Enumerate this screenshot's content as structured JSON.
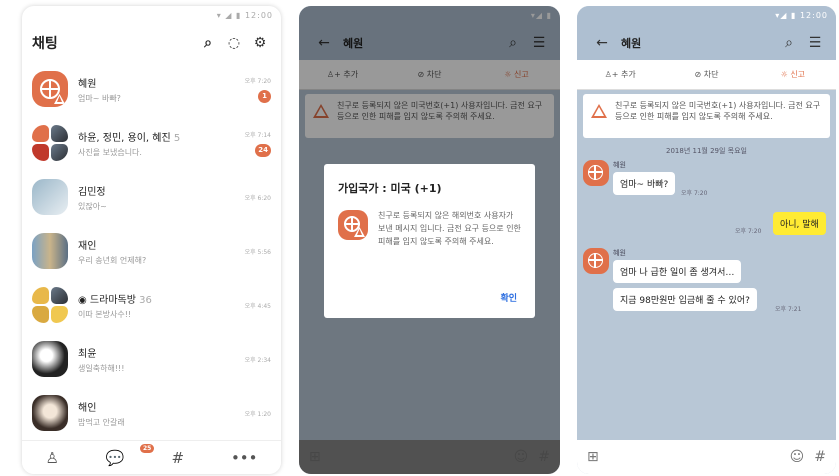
{
  "status_time": "12:00",
  "screen1": {
    "title": "채팅",
    "chats": [
      {
        "name": "혜원",
        "count": "",
        "preview": "엄마~ 바빠?",
        "time": "오후 7:20",
        "badge": "1",
        "avatar": "globe"
      },
      {
        "name": "하윤, 정민, 용이, 혜진",
        "count": "5",
        "preview": "사진을 보냈습니다.",
        "time": "오후 7:14",
        "badge": "24",
        "avatar": "group"
      },
      {
        "name": "김민정",
        "count": "",
        "preview": "있잖아~",
        "time": "오후 6:20",
        "badge": "",
        "avatar": "photo"
      },
      {
        "name": "재인",
        "count": "",
        "preview": "우리 송년회 언제해?",
        "time": "오후 5:56",
        "badge": "",
        "avatar": "photo"
      },
      {
        "name": "드라마독방",
        "count": "36",
        "preview": "이따 본방사수!!",
        "time": "오후 4:45",
        "badge": "",
        "avatar": "group"
      },
      {
        "name": "최윤",
        "count": "",
        "preview": "생일축하해!!!",
        "time": "오후 2:34",
        "badge": "",
        "avatar": "photo"
      },
      {
        "name": "해인",
        "count": "",
        "preview": "밥먹고 안갈래",
        "time": "오후 1:20",
        "badge": "",
        "avatar": "photo"
      }
    ],
    "nav_badge": "25"
  },
  "screen2": {
    "title": "혜원",
    "actions": {
      "add": "추가",
      "block": "차단",
      "report": "신고"
    },
    "notice": "친구로 등록되지 않은 미국번호(+1) 사용자입니다. 금전 요구 등으로 인한 피해를 입지 않도록 주의해 주세요.",
    "dialog": {
      "title": "가입국가 : 미국 (+1)",
      "body": "친구로 등록되지 않은 해외번호 사용자가 보낸 메시지 입니다. 금전 요구 등으로 인한 피해를 입지 않도록 주의해 주세요.",
      "ok": "확인"
    }
  },
  "screen3": {
    "title": "혜원",
    "actions": {
      "add": "추가",
      "block": "차단",
      "report": "신고"
    },
    "notice": "친구로 등록되지 않은 미국번호(+1) 사용자입니다. 금전 요구 등으로 인한 피해를 입지 않도록 주의해 주세요.",
    "date": "2018년 11월 29일 목요일",
    "messages": [
      {
        "sender": "혜원",
        "text": "엄마~ 바빠?",
        "time": "오후 7:20"
      },
      {
        "mine": true,
        "text": "아니, 말해",
        "time": "오후 7:20"
      },
      {
        "sender": "혜원",
        "text": "엄마 나 급한 일이 좀 생겨서…"
      },
      {
        "text": "지금 98만원만 입금해 줄 수 있어?",
        "time": "오후 7:21"
      }
    ]
  },
  "colors": {
    "accent": "#e0704a",
    "chat_bg": "#b8c7d6",
    "my_bubble": "#ffeb33",
    "link": "#2e6fe0"
  }
}
